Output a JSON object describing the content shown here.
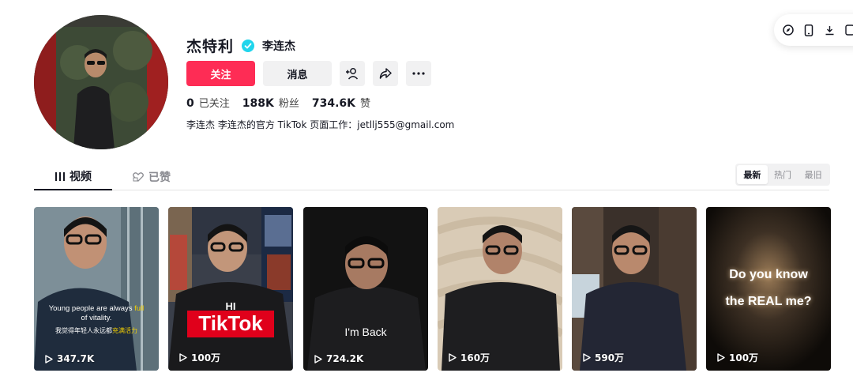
{
  "profile": {
    "nickname": "杰特利",
    "username": "李连杰",
    "follow_label": "关注",
    "message_label": "消息",
    "bio": "李连杰 李连杰的官方 TikTok 页面工作：jetllj555@gmail.com",
    "stats": [
      {
        "num": "0",
        "label": "已关注"
      },
      {
        "num": "188K",
        "label": "粉丝"
      },
      {
        "num": "734.6K",
        "label": "赞"
      }
    ]
  },
  "tabs": {
    "videos": "视频",
    "liked": "已赞"
  },
  "sort": [
    "最新",
    "热门",
    "最旧"
  ],
  "videos": [
    {
      "views": "347.7K",
      "caption_en_1": "Young people are always ",
      "caption_en_hl1": "full",
      "caption_en_2": "of vitality.",
      "caption_zh_1": "我觉得年轻人永远都",
      "caption_zh_hl": "充满活力"
    },
    {
      "views": "100万",
      "hi": "HI",
      "tiktok": "TikTok"
    },
    {
      "views": "724.2K",
      "caption": "I'm Back"
    },
    {
      "views": "160万"
    },
    {
      "views": "590万"
    },
    {
      "views": "100万",
      "line1": "Do you know",
      "line2": "the REAL me?"
    }
  ],
  "colors": {
    "accent": "#fe2c55",
    "verified": "#20d5ec",
    "text": "#161823"
  }
}
